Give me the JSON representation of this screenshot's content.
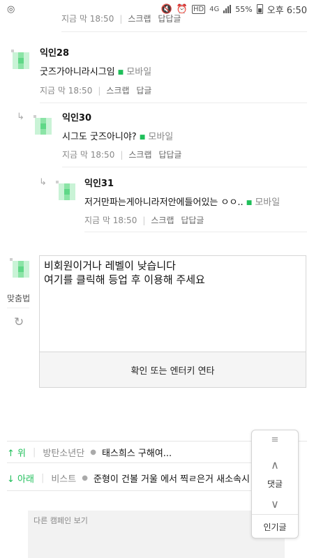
{
  "status_bar": {
    "app_icon": "o-icon",
    "network": "4G",
    "battery": "55%",
    "time": "오후 6:50"
  },
  "top_partial": {
    "time": "지금 막 18:50",
    "scrap": "스크랩",
    "reply": "답답글"
  },
  "comments": [
    {
      "nick": "익인28",
      "text": "굿즈가아니라시그임",
      "device": "모바일",
      "time": "지금 막 18:50",
      "scrap": "스크랩",
      "reply": "답글"
    },
    {
      "nick": "익인30",
      "text": "시그도 굿즈아니야?",
      "device": "모바일",
      "time": "지금 막 18:50",
      "scrap": "스크랩",
      "reply": "답답글"
    },
    {
      "nick": "익인31",
      "text": "저거만파는게아니라저안에들어있는 ㅇㅇ..",
      "device": "모바일",
      "time": "지금 막 18:50",
      "scrap": "스크랩",
      "reply": "답답글"
    }
  ],
  "write": {
    "placeholder_line1": "비회원이거나 레벨이 낮습니다",
    "placeholder_line2": "여기를 클릭해 등업 후 이용해 주세요",
    "spell_check": "맞춤법",
    "submit": "확인 또는 엔터키 연타"
  },
  "nav": {
    "up": {
      "dir": "↑ 위",
      "gallery": "방탄소년단",
      "title": "태스희스 구해여..."
    },
    "down": {
      "dir": "↓ 아래",
      "gallery": "비스트",
      "title": "준형이 건볼 거울 에서 찍ㄹ은거 새소속시"
    }
  },
  "campaign": "다른 캠페인 보기",
  "floating": {
    "menu": "≡",
    "reply": "댓글",
    "popular": "인기글"
  }
}
